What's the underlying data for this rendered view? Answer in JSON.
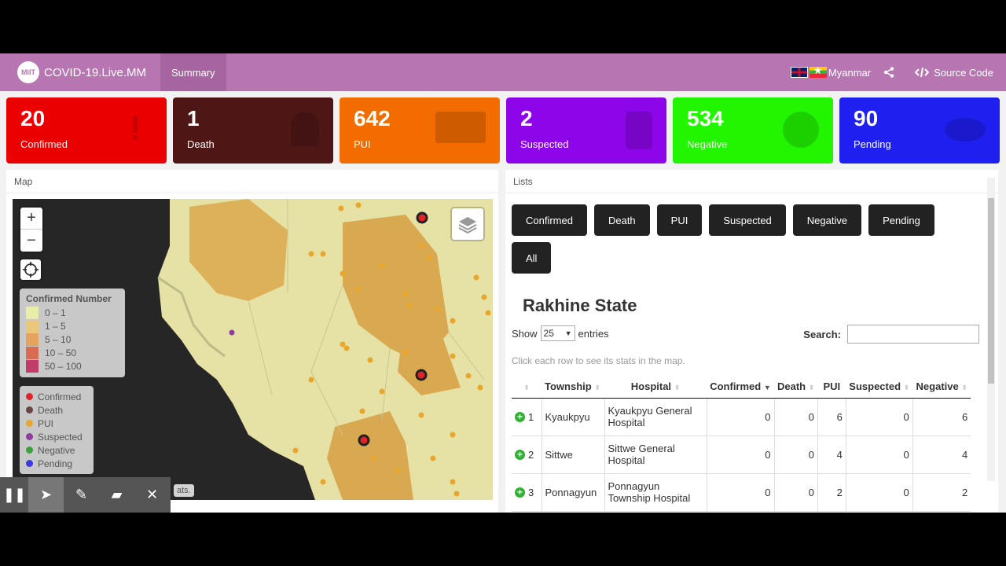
{
  "nav": {
    "brand": "COVID-19.Live.MM",
    "logo_text": "MIIT",
    "tab_summary": "Summary",
    "language": "Myanmar",
    "source_code": "Source Code"
  },
  "stats": [
    {
      "value": "20",
      "label": "Confirmed",
      "color": "#ea0000"
    },
    {
      "value": "1",
      "label": "Death",
      "color": "#4e1716"
    },
    {
      "value": "642",
      "label": "PUI",
      "color": "#f36c00"
    },
    {
      "value": "2",
      "label": "Suspected",
      "color": "#8d05e9"
    },
    {
      "value": "534",
      "label": "Negative",
      "color": "#22f500"
    },
    {
      "value": "90",
      "label": "Pending",
      "color": "#1f1ff0"
    }
  ],
  "map_panel": {
    "title": "Map",
    "zoom_in": "+",
    "zoom_out": "−",
    "attribution": "ats."
  },
  "legend_confirmed": {
    "title": "Confirmed Number",
    "rows": [
      {
        "label": "0 – 1",
        "color": "#e8edaa"
      },
      {
        "label": "1 – 5",
        "color": "#ebc77a"
      },
      {
        "label": "5 – 10",
        "color": "#e5a35e"
      },
      {
        "label": "10 – 50",
        "color": "#d96b52"
      },
      {
        "label": "50 – 100",
        "color": "#c13c6a"
      }
    ]
  },
  "legend_status": [
    {
      "label": "Confirmed",
      "color": "#e2242a"
    },
    {
      "label": "Death",
      "color": "#6b4545"
    },
    {
      "label": "PUI",
      "color": "#e8a62c"
    },
    {
      "label": "Suspected",
      "color": "#8e3ca0"
    },
    {
      "label": "Negative",
      "color": "#3aa23a"
    },
    {
      "label": "Pending",
      "color": "#3a3ae0"
    }
  ],
  "lists_panel": {
    "title": "Lists",
    "buttons": [
      "Confirmed",
      "Death",
      "PUI",
      "Suspected",
      "Negative",
      "Pending",
      "All"
    ],
    "state_title": "Rakhine State",
    "show_label": "Show",
    "entries_value": "25",
    "entries_label": "entries",
    "search_label": "Search:",
    "hint": "Click each row to see its stats in the map."
  },
  "table": {
    "headers": [
      "",
      "Township",
      "Hospital",
      "Confirmed",
      "Death",
      "PUI",
      "Suspected",
      "Negative"
    ],
    "rows": [
      {
        "n": "1",
        "township": "Kyaukpyu",
        "hospital": "Kyaukpyu General Hospital",
        "confirmed": "0",
        "death": "0",
        "pui": "6",
        "suspected": "0",
        "negative": "6"
      },
      {
        "n": "2",
        "township": "Sittwe",
        "hospital": "Sittwe General Hospital",
        "confirmed": "0",
        "death": "0",
        "pui": "4",
        "suspected": "0",
        "negative": "4"
      },
      {
        "n": "3",
        "township": "Ponnagyun",
        "hospital": "Ponnagyun Township Hospital",
        "confirmed": "0",
        "death": "0",
        "pui": "2",
        "suspected": "0",
        "negative": "2"
      }
    ]
  }
}
